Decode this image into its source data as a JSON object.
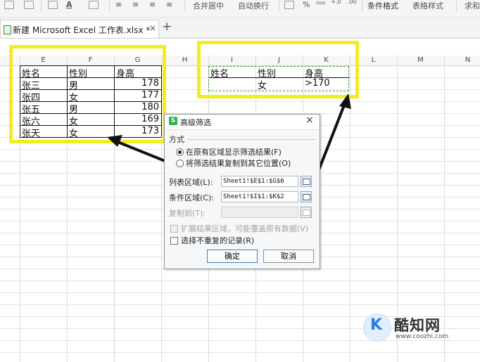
{
  "ribbon": {
    "merge_center": "合并居中",
    "auto_wrap": "自动换行",
    "percent": "%",
    "conditional_format": "条件格式",
    "table_style": "表格样式",
    "sum_partial": "求和"
  },
  "tabs": [
    {
      "label": "新建 Microsoft Excel 工作表.xlsx *",
      "close": "×"
    }
  ],
  "new_tab": "+",
  "columns": [
    "E",
    "F",
    "G",
    "H",
    "I",
    "J",
    "K",
    "L",
    "M",
    "N"
  ],
  "list_table": {
    "headers": [
      "姓名",
      "性别",
      "身高"
    ],
    "rows": [
      [
        "张三",
        "男",
        "178"
      ],
      [
        "张四",
        "女",
        "177"
      ],
      [
        "张五",
        "男",
        "180"
      ],
      [
        "张六",
        "女",
        "169"
      ],
      [
        "张天",
        "女",
        "173"
      ]
    ]
  },
  "criteria_table": {
    "headers": [
      "姓名",
      "性别",
      "身高"
    ],
    "row": [
      "",
      "女",
      ">170"
    ]
  },
  "dialog": {
    "title": "高级筛选",
    "close": "×",
    "method_label": "方式",
    "option_in_place": "在原有区域显示筛选结果(F)",
    "option_copy": "将筛选结果复制到其它位置(O)",
    "list_range_label": "列表区域(L):",
    "list_range_value": "Sheet1!$E$1:$G$6",
    "criteria_range_label": "条件区域(C):",
    "criteria_range_value": "Sheet1!$I$1:$K$2",
    "copy_to_label": "复制到(T):",
    "copy_to_value": "",
    "expand_label": "扩展结果区域，可能覆盖原有数据(V)",
    "unique_label": "选择不重复的记录(R)",
    "ok": "确定",
    "cancel": "取消",
    "selected_option": "在原有区域显示筛选结果(F)"
  },
  "watermark": {
    "name": "酷知网",
    "url": "www.coozhi.com"
  },
  "colors": {
    "highlight": "#f2ec23",
    "accent": "#3c7fd6",
    "criteria_border": "#4a9d3a"
  }
}
